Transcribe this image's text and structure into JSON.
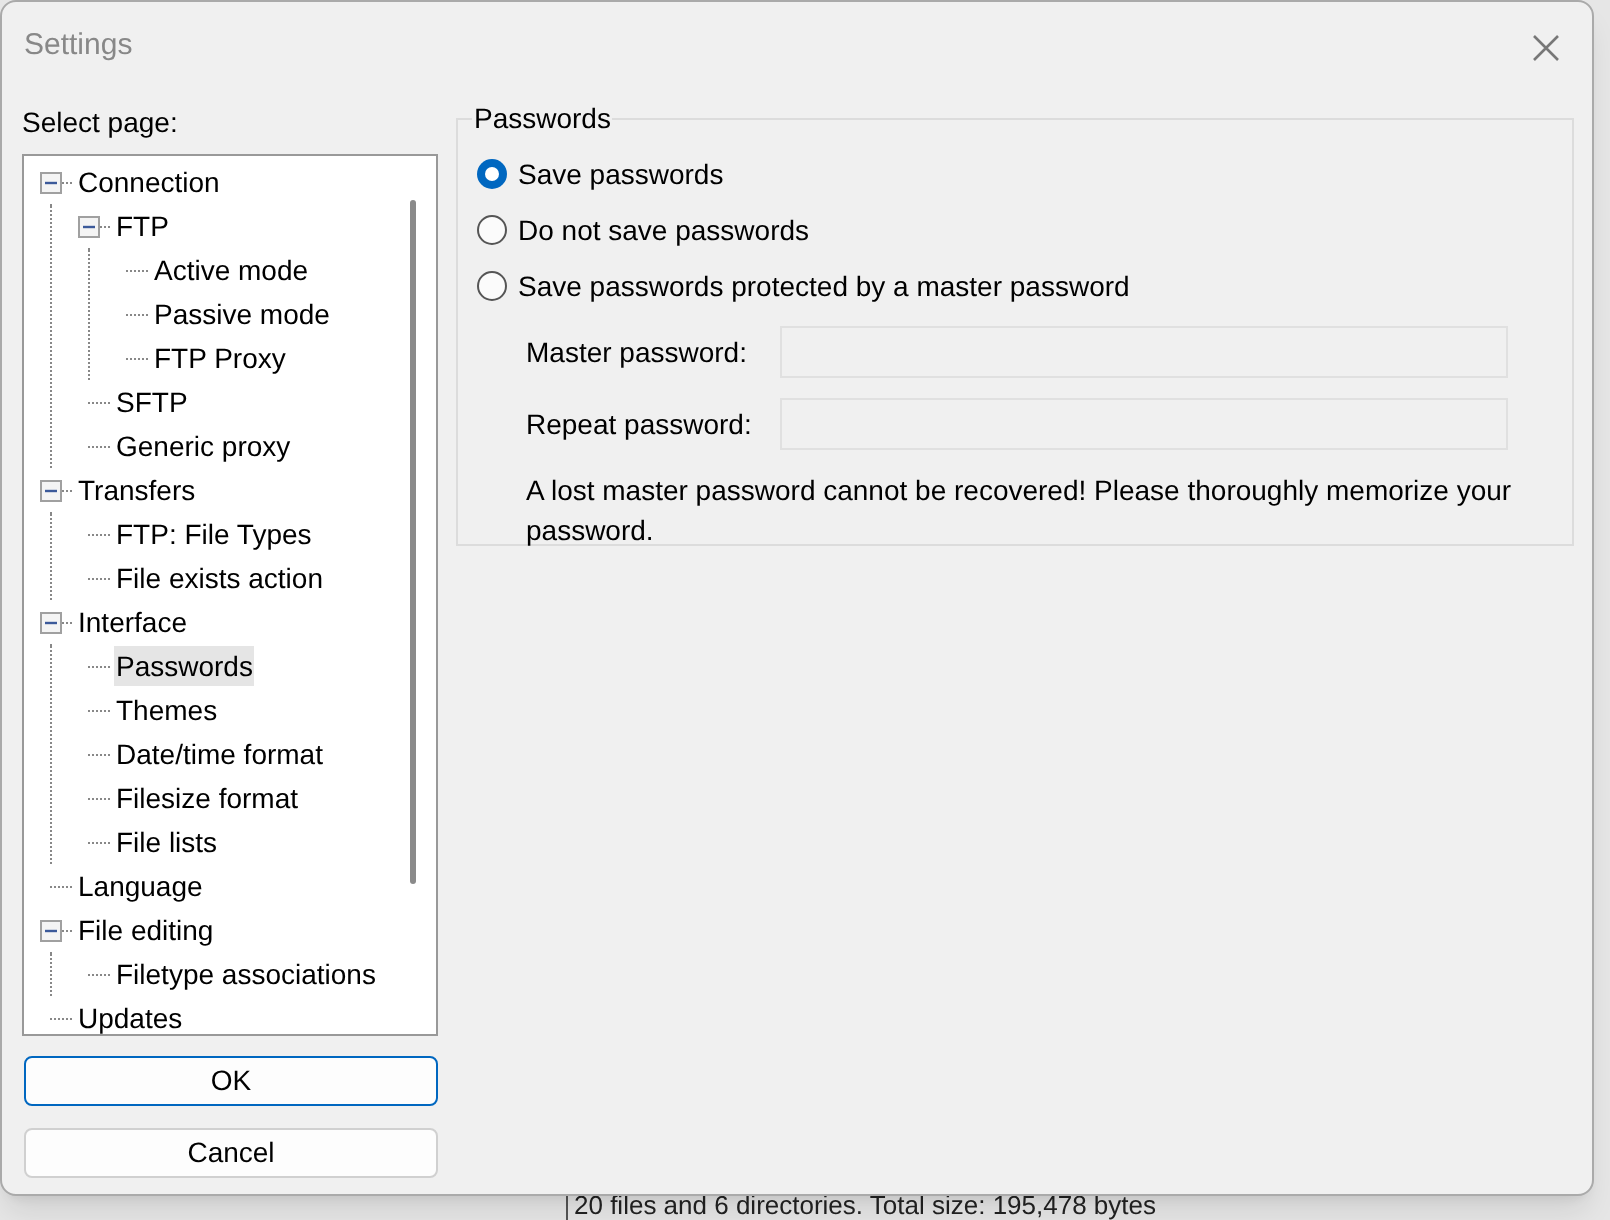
{
  "window": {
    "title": "Settings"
  },
  "select_page_label": "Select page:",
  "tree": [
    {
      "label": "Connection",
      "selected": false,
      "expanded": true,
      "children": [
        {
          "label": "FTP",
          "selected": false,
          "expanded": true,
          "children": [
            {
              "label": "Active mode",
              "selected": false
            },
            {
              "label": "Passive mode",
              "selected": false
            },
            {
              "label": "FTP Proxy",
              "selected": false
            }
          ]
        },
        {
          "label": "SFTP",
          "selected": false
        },
        {
          "label": "Generic proxy",
          "selected": false
        }
      ]
    },
    {
      "label": "Transfers",
      "selected": false,
      "expanded": true,
      "children": [
        {
          "label": "FTP: File Types",
          "selected": false
        },
        {
          "label": "File exists action",
          "selected": false
        }
      ]
    },
    {
      "label": "Interface",
      "selected": false,
      "expanded": true,
      "children": [
        {
          "label": "Passwords",
          "selected": true
        },
        {
          "label": "Themes",
          "selected": false
        },
        {
          "label": "Date/time format",
          "selected": false
        },
        {
          "label": "Filesize format",
          "selected": false
        },
        {
          "label": "File lists",
          "selected": false
        }
      ]
    },
    {
      "label": "Language",
      "selected": false
    },
    {
      "label": "File editing",
      "selected": false,
      "expanded": true,
      "children": [
        {
          "label": "Filetype associations",
          "selected": false
        }
      ]
    },
    {
      "label": "Updates",
      "selected": false
    }
  ],
  "buttons": [
    {
      "label": "OK",
      "default": true
    },
    {
      "label": "Cancel",
      "default": false
    }
  ],
  "group": {
    "title": "Passwords",
    "options": [
      {
        "label": "Save passwords",
        "selected": true
      },
      {
        "label": "Do not save passwords",
        "selected": false
      },
      {
        "label": "Save passwords protected by a master password",
        "selected": false
      }
    ],
    "fields": [
      {
        "label": "Master password:"
      },
      {
        "label": "Repeat password:"
      }
    ],
    "note": "A lost master password cannot be recovered! Please thoroughly memorize your password."
  },
  "background_status": "20 files and 6 directories. Total size: 195,478 bytes"
}
